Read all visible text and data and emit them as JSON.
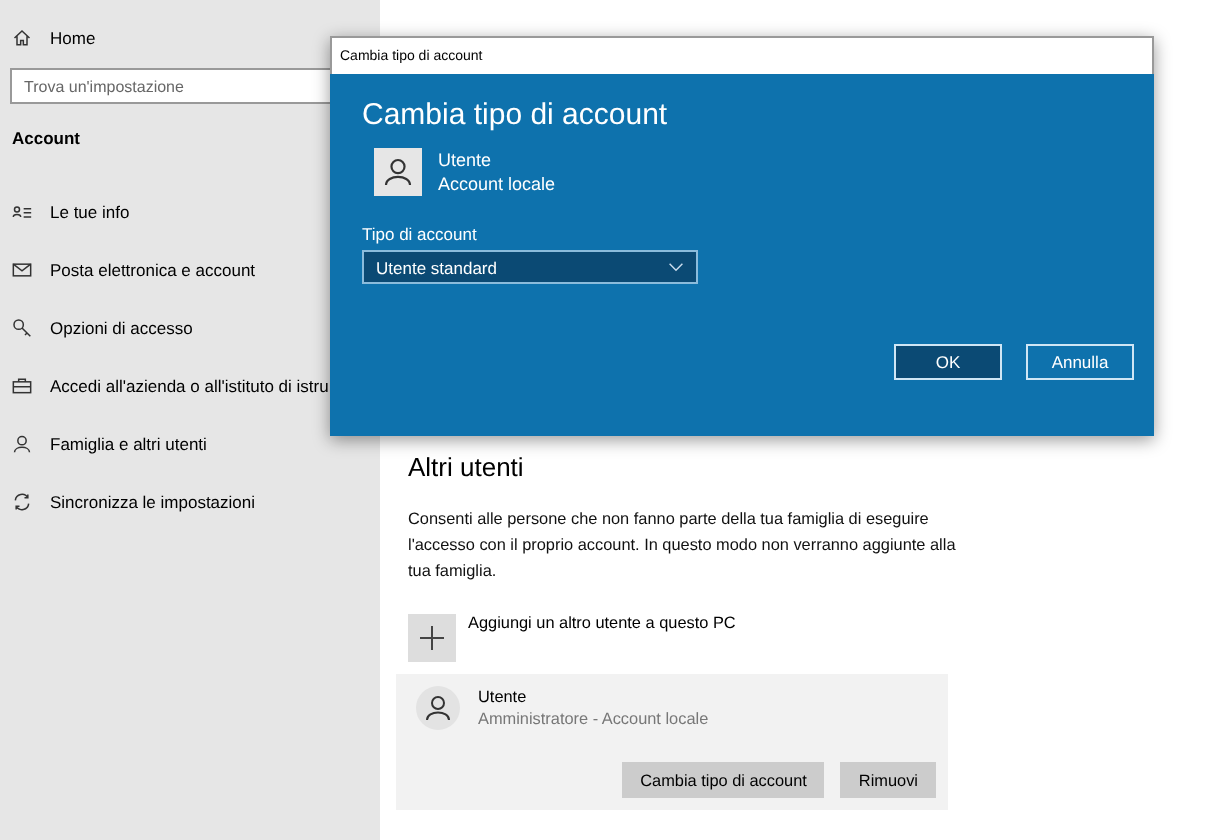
{
  "sidebar": {
    "home": "Home",
    "search": {
      "placeholder": "Trova un'impostazione"
    },
    "section": "Account",
    "items": [
      {
        "label": "Le tue info",
        "kind": "info"
      },
      {
        "label": "Posta elettronica e account",
        "kind": "mail"
      },
      {
        "label": "Opzioni di accesso",
        "kind": "key"
      },
      {
        "label": "Accedi all'azienda o all'istituto di istru",
        "kind": "briefcase"
      },
      {
        "label": "Famiglia e altri utenti",
        "kind": "person"
      },
      {
        "label": "Sincronizza le impostazioni",
        "kind": "sync"
      }
    ]
  },
  "page": {
    "section": "Altri utenti",
    "description": "Consenti alle persone che non fanno parte della tua famiglia di eseguire l'accesso con il proprio account. In questo modo non verranno aggiunte alla tua famiglia.",
    "add_user": "Aggiungi un altro utente a questo PC",
    "user": {
      "name": "Utente",
      "detail": "Amministratore - Account locale",
      "buttons": [
        "Cambia tipo di account",
        "Rimuovi"
      ]
    }
  },
  "dialog": {
    "window_title": "Cambia tipo di account",
    "heading": "Cambia tipo di account",
    "user_name": "Utente",
    "user_detail": "Account locale",
    "field_label": "Tipo di account",
    "field_value": "Utente standard",
    "buttons": [
      {
        "label": "OK",
        "kind": "primary"
      },
      {
        "label": "Annulla",
        "kind": "secondary"
      }
    ]
  }
}
